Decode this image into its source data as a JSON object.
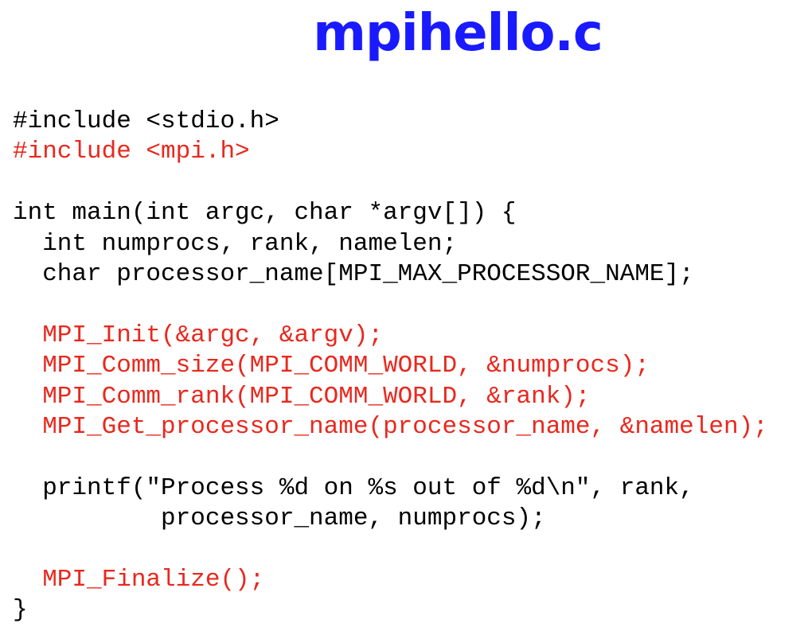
{
  "title": "mpihello.c",
  "colors": {
    "title": "#1a1aff",
    "code_normal": "#000000",
    "code_mpi": "#e8281e"
  },
  "code_lines": [
    {
      "text": "#include <stdio.h>",
      "style": "normal"
    },
    {
      "text": "#include <mpi.h>",
      "style": "mpi"
    },
    {
      "text": "",
      "style": "normal"
    },
    {
      "text": "int main(int argc, char *argv[]) {",
      "style": "normal"
    },
    {
      "text": "  int numprocs, rank, namelen;",
      "style": "normal"
    },
    {
      "text": "  char processor_name[MPI_MAX_PROCESSOR_NAME];",
      "style": "normal"
    },
    {
      "text": "",
      "style": "normal"
    },
    {
      "text": "  MPI_Init(&argc, &argv);",
      "style": "mpi"
    },
    {
      "text": "  MPI_Comm_size(MPI_COMM_WORLD, &numprocs);",
      "style": "mpi"
    },
    {
      "text": "  MPI_Comm_rank(MPI_COMM_WORLD, &rank);",
      "style": "mpi"
    },
    {
      "text": "  MPI_Get_processor_name(processor_name, &namelen);",
      "style": "mpi"
    },
    {
      "text": "",
      "style": "normal"
    },
    {
      "text": "  printf(\"Process %d on %s out of %d\\n\", rank,",
      "style": "normal"
    },
    {
      "text": "          processor_name, numprocs);",
      "style": "normal"
    },
    {
      "text": "",
      "style": "normal"
    },
    {
      "text": "  MPI_Finalize();",
      "style": "mpi"
    },
    {
      "text": "}",
      "style": "normal"
    }
  ]
}
